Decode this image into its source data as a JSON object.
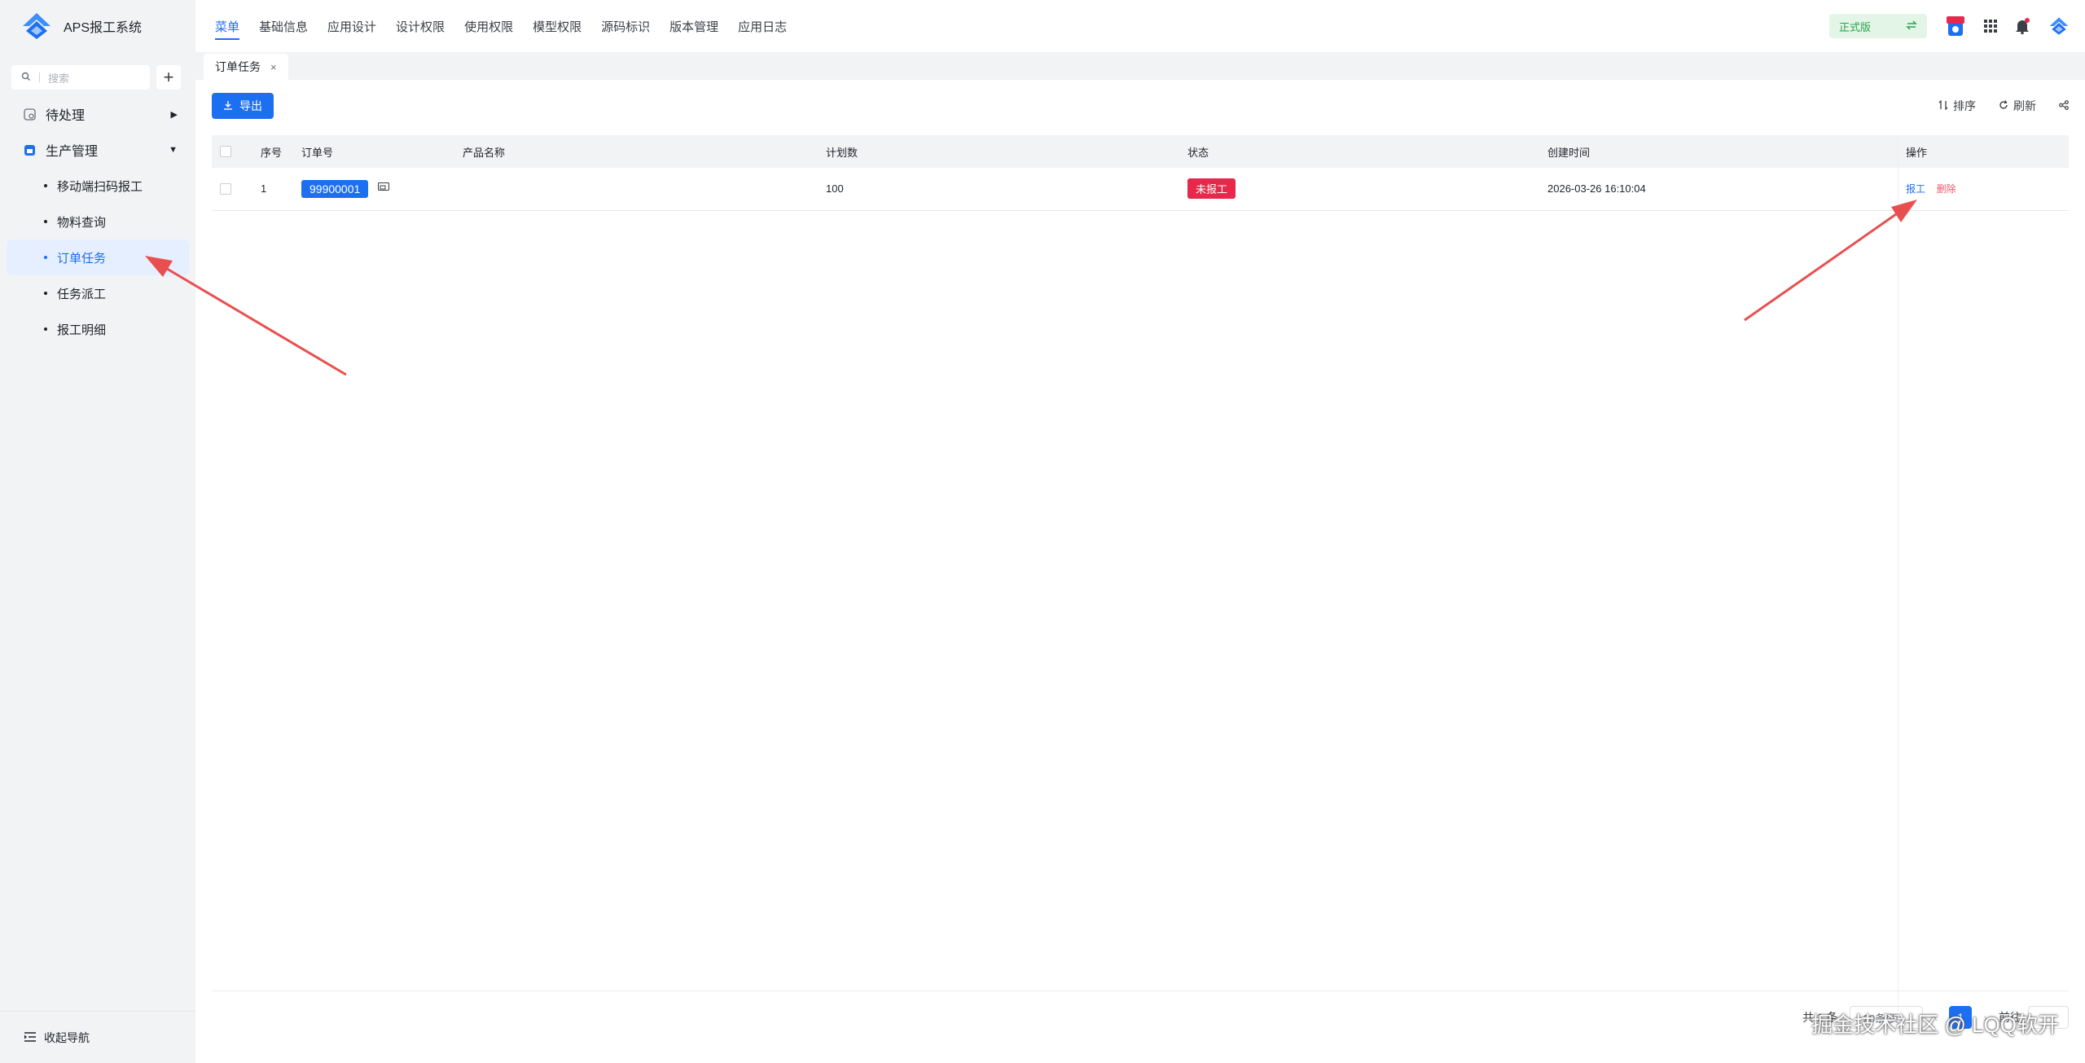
{
  "app": {
    "title": "APS报工系统"
  },
  "sidebar": {
    "search_placeholder": "搜索",
    "groups": [
      {
        "label": "待处理",
        "icon": "pending-icon"
      },
      {
        "label": "生产管理",
        "icon": "production-icon"
      }
    ],
    "items": [
      {
        "label": "移动端扫码报工"
      },
      {
        "label": "物料查询"
      },
      {
        "label": "订单任务"
      },
      {
        "label": "任务派工"
      },
      {
        "label": "报工明细"
      }
    ],
    "collapse_label": "收起导航"
  },
  "topnav": {
    "items": [
      "菜单",
      "基础信息",
      "应用设计",
      "设计权限",
      "使用权限",
      "模型权限",
      "源码标识",
      "版本管理",
      "应用日志"
    ],
    "edition": "正式版"
  },
  "tabs": [
    {
      "label": "订单任务",
      "close": "×"
    }
  ],
  "toolbar": {
    "export_label": "导出",
    "sort_label": "排序",
    "refresh_label": "刷新"
  },
  "table": {
    "headers": [
      "序号",
      "订单号",
      "产品名称",
      "计划数",
      "状态",
      "创建时间",
      "操作"
    ],
    "rows": [
      {
        "index": "1",
        "order_no": "99900001",
        "product": "",
        "plan_qty": "100",
        "status": "未报工",
        "created": "2026-03-26 16:10:04",
        "op_report": "报工",
        "op_delete": "删除"
      }
    ]
  },
  "pagination": {
    "total": "共 1 条",
    "page_size": "20条/页",
    "current": "1",
    "jump": "前往"
  },
  "credit": "掘金技术社区 @ LQQ软开",
  "colors": {
    "accent": "#1d6ff2",
    "status_red": "#e8284a",
    "edition_green": "#2aa34a",
    "annotation": "#e8504f"
  }
}
